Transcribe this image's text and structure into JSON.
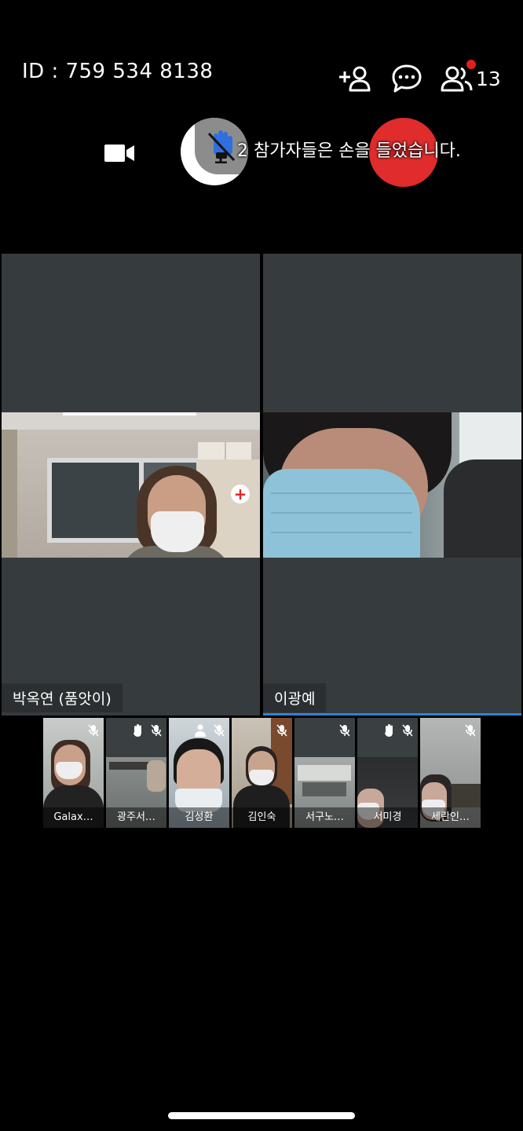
{
  "header": {
    "meeting_id": "ID : 759 534 8138",
    "participant_count": "13"
  },
  "notice": {
    "raised_hands": "2 참가자들은 손을 들었습니다."
  },
  "main_videos": [
    {
      "name": "박옥연 (품앗이)"
    },
    {
      "name": "이광예",
      "active_speaker": true
    }
  ],
  "thumbnails": [
    {
      "name": "Galax…",
      "hand_raised": false,
      "muted": true
    },
    {
      "name": "광주서…",
      "hand_raised": true,
      "muted": true
    },
    {
      "name": "김성환",
      "hand_raised": false,
      "muted": true,
      "video_off_icon": true
    },
    {
      "name": "김인숙",
      "hand_raised": false,
      "muted": true
    },
    {
      "name": "서구노…",
      "hand_raised": false,
      "muted": true
    },
    {
      "name": "서미경",
      "hand_raised": true,
      "muted": true
    },
    {
      "name": "세란인…",
      "hand_raised": false,
      "muted": true
    }
  ],
  "colors": {
    "background": "#000000",
    "tile": "#363b3e",
    "active_speaker": "#2f84d6",
    "end_call": "#e02c2c",
    "notification_dot": "#e02020",
    "mic_icon": "#2f6fe0"
  },
  "icons": [
    "add-person-icon",
    "chat-icon",
    "participants-icon",
    "video-camera-icon",
    "mic-off-icon",
    "raise-hand-icon",
    "end-call-icon"
  ]
}
